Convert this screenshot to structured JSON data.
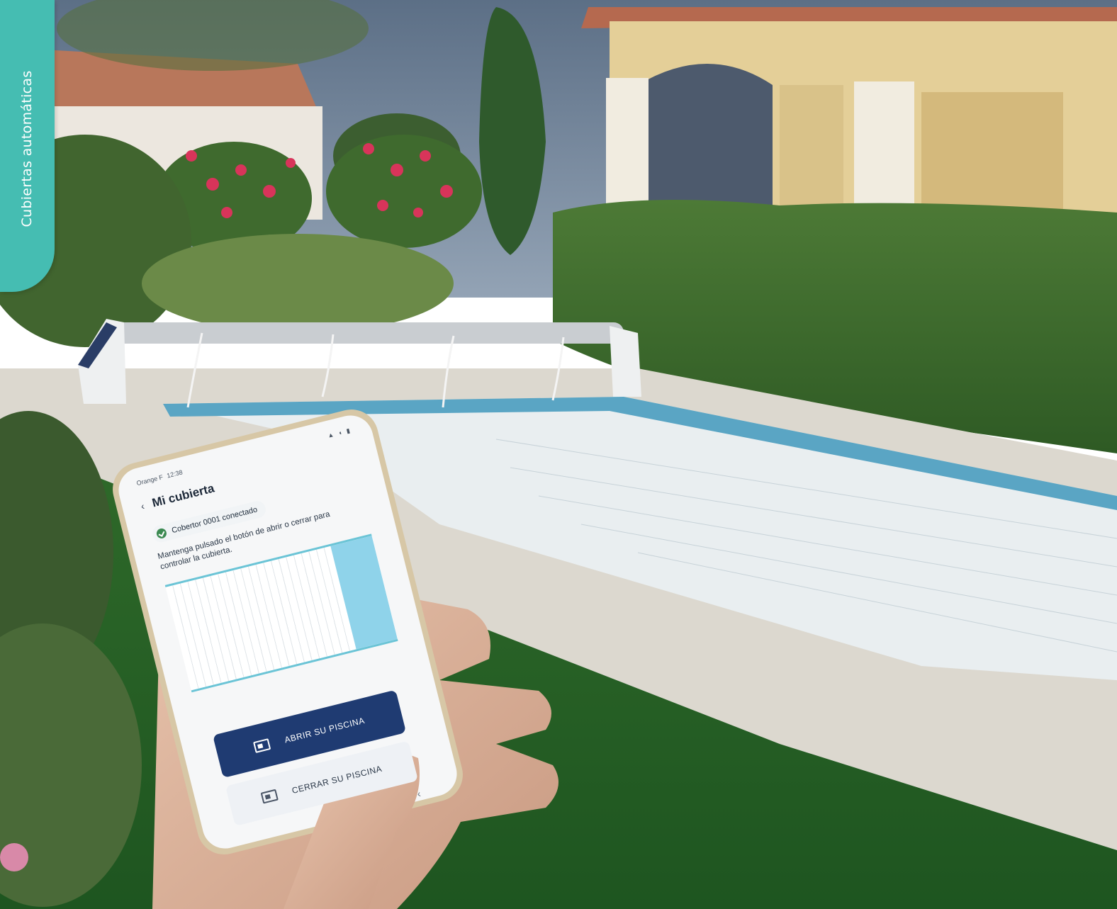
{
  "side_tab": {
    "label": "Cubiertas automáticas",
    "color": "#45bdb2"
  },
  "app": {
    "status": {
      "carrier": "Orange F",
      "time": "12:38",
      "icons": "▲ ◖ ▮"
    },
    "header": {
      "title": "Mi cubierta",
      "back_icon": "chevron-left-icon"
    },
    "connection": {
      "text": "Cobertor 0001 conectado",
      "status_color": "#3c8a52"
    },
    "instruction": "Mantenga pulsado el botón de abrir o cerrar para controlar la cubierta.",
    "cover": {
      "open_fraction": 0.2,
      "water_color": "#8fd3ea"
    },
    "buttons": {
      "open_label": "ABRIR SU PISCINA",
      "close_label": "CERRAR SU PISCINA",
      "primary_color": "#1f3b72"
    },
    "nav": {
      "back_icon": "nav-back-icon"
    }
  }
}
